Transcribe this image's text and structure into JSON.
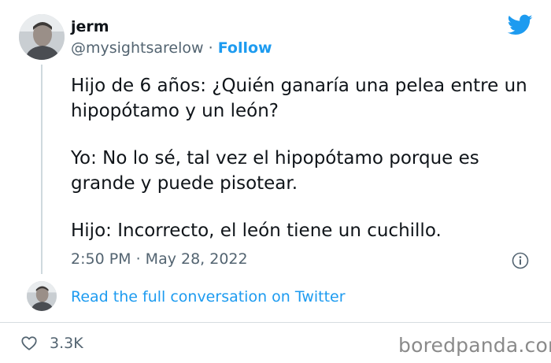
{
  "tweet": {
    "author_name": "jerm",
    "handle": "@mysightsarelow",
    "separator": "·",
    "follow_label": "Follow",
    "paragraphs": [
      "Hijo de 6 años: ¿Quién ganaría una pelea entre un hipopótamo y un león?",
      "Yo: No lo sé, tal vez el hipopótamo porque es grande y puede pisotear.",
      "Hijo: Incorrecto, el león tiene un cuchillo."
    ],
    "timestamp": "2:50 PM · May 28, 2022",
    "read_more_label": "Read the full conversation on Twitter",
    "likes": "3.3K"
  },
  "watermark": "boredpanda.com",
  "icons": {
    "brand": "twitter-bird-icon",
    "info": "info-icon",
    "like": "heart-icon"
  },
  "colors": {
    "accent": "#1d9bf0",
    "text": "#0f1419",
    "secondary": "#536471"
  }
}
